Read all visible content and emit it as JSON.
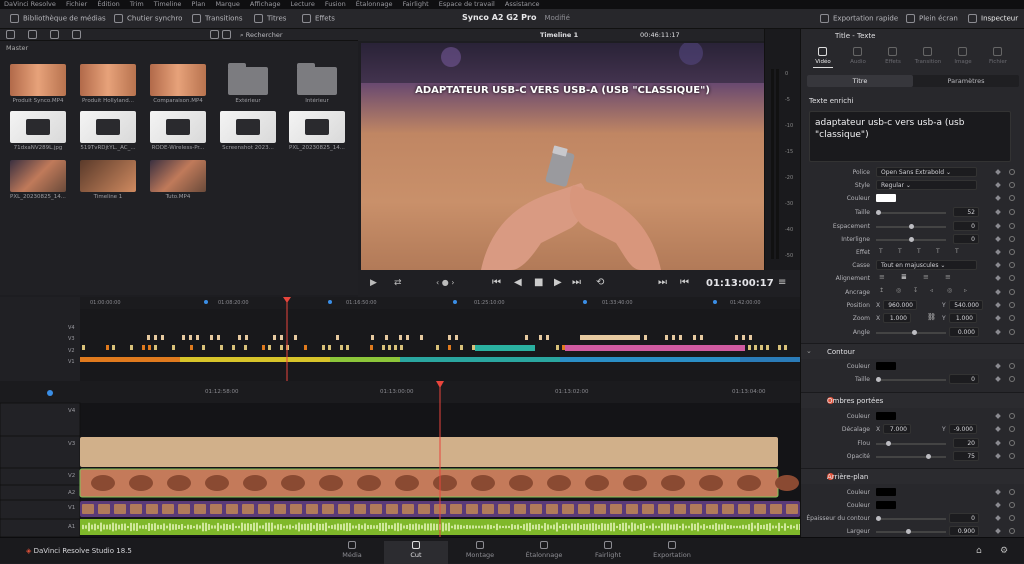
{
  "menubar": [
    "DaVinci Resolve",
    "Fichier",
    "Édition",
    "Trim",
    "Timeline",
    "Plan",
    "Marque",
    "Affichage",
    "Lecture",
    "Fusion",
    "Étalonnage",
    "Fairlight",
    "Espace de travail",
    "Assistance"
  ],
  "toolbar": {
    "media_pool": "Bibliothèque de médias",
    "sync_bin": "Chutier synchro",
    "transitions": "Transitions",
    "titles": "Titres",
    "effects": "Effets",
    "quick_export": "Exportation rapide",
    "fullscreen": "Plein écran",
    "inspector": "Inspecteur"
  },
  "project": {
    "name": "Synco A2 G2 Pro",
    "status": "Modifié"
  },
  "subbar": {
    "search": "Rechercher",
    "timeline": "Timeline 1",
    "timecode": "00:46:11:17"
  },
  "media": {
    "bin": "Master",
    "items": [
      {
        "label": "Produit Synco.MP4",
        "kind": "warm"
      },
      {
        "label": "Produit Hollyland...",
        "kind": "warm"
      },
      {
        "label": "Comparaison.MP4",
        "kind": "warm"
      },
      {
        "label": "Extérieur",
        "kind": "folder"
      },
      {
        "label": "Intérieur",
        "kind": "folder"
      },
      {
        "label": "71dxaNV289L.jpg",
        "kind": "white"
      },
      {
        "label": "519TvRDjtYL._AC_...",
        "kind": "white"
      },
      {
        "label": "RODE-Wireless-Pr...",
        "kind": "white"
      },
      {
        "label": "Screenshot 2023...",
        "kind": "white"
      },
      {
        "label": "PXL_20230825_14...",
        "kind": "white"
      },
      {
        "label": "PXL_20230825_14...",
        "kind": "room"
      },
      {
        "label": "Timeline 1",
        "kind": "timeline"
      },
      {
        "label": "Tuto.MP4",
        "kind": "room"
      }
    ]
  },
  "viewer": {
    "overlay_text": "ADAPTATEUR USB-C VERS USB-A (USB \"CLASSIQUE\")",
    "timecode": "01:13:00:17"
  },
  "meter_ticks": [
    "0",
    "-5",
    "-10",
    "-15",
    "-20",
    "-30",
    "-40",
    "-50"
  ],
  "mini_ruler": [
    "01:00:00:00",
    "01:08:20:00",
    "01:16:50:00",
    "01:25:10:00",
    "01:33:40:00",
    "01:42:00:00"
  ],
  "main_ruler": [
    "01:12:58:00",
    "01:13:00:00",
    "01:13:02:00",
    "01:13:04:00"
  ],
  "tracks": [
    "V4",
    "V3",
    "V2",
    "A2",
    "V1",
    "A1"
  ],
  "mini_tracks": [
    "V4",
    "V3",
    "V2",
    "V1"
  ],
  "inspector": {
    "title": "Title - Texte",
    "tabs": [
      "Vidéo",
      "Audio",
      "Effets",
      "Transition",
      "Image",
      "Fichier"
    ],
    "subtabs": [
      "Titre",
      "Paramètres"
    ],
    "section_text": "Texte enrichi",
    "text_value": "adaptateur usb-c vers usb-a (usb \"classique\")",
    "props": {
      "font_label": "Police",
      "font": "Open Sans Extrabold",
      "style_label": "Style",
      "style": "Regular",
      "color_label": "Couleur",
      "size_label": "Taille",
      "size": "52",
      "spacing_label": "Espacement",
      "spacing": "0",
      "leading_label": "Interligne",
      "leading": "0",
      "effect_label": "Effet",
      "case_label": "Casse",
      "case": "Tout en majuscules",
      "align_label": "Alignement",
      "anchor_label": "Ancrage",
      "pos_label": "Position",
      "pos_x": "960.000",
      "pos_y": "540.000",
      "zoom_label": "Zoom",
      "zoom_x": "1.000",
      "zoom_y": "1.000",
      "angle_label": "Angle",
      "angle": "0.000",
      "x": "X",
      "y": "Y"
    },
    "contour": {
      "title": "Contour",
      "color_label": "Couleur",
      "size_label": "Taille",
      "size": "0"
    },
    "shadow": {
      "title": "Ombres portées",
      "color_label": "Couleur",
      "offset_label": "Décalage",
      "offset_x": "7.000",
      "offset_y": "-9.000",
      "blur_label": "Flou",
      "blur": "20",
      "opacity_label": "Opacité",
      "opacity": "75"
    },
    "background": {
      "title": "Arrière-plan",
      "color_label": "Couleur",
      "color2_label": "Couleur",
      "border_label": "Épaisseur du contour",
      "border": "0",
      "width_label": "Largeur",
      "width": "0.900"
    }
  },
  "bottom": {
    "app": "DaVinci Resolve Studio 18.5",
    "nav": [
      "Média",
      "Cut",
      "Montage",
      "Étalonnage",
      "Fairlight",
      "Exportation"
    ],
    "active": "Cut"
  },
  "colors": {
    "playhead": "#e8453c",
    "accent": "#e0523a"
  }
}
